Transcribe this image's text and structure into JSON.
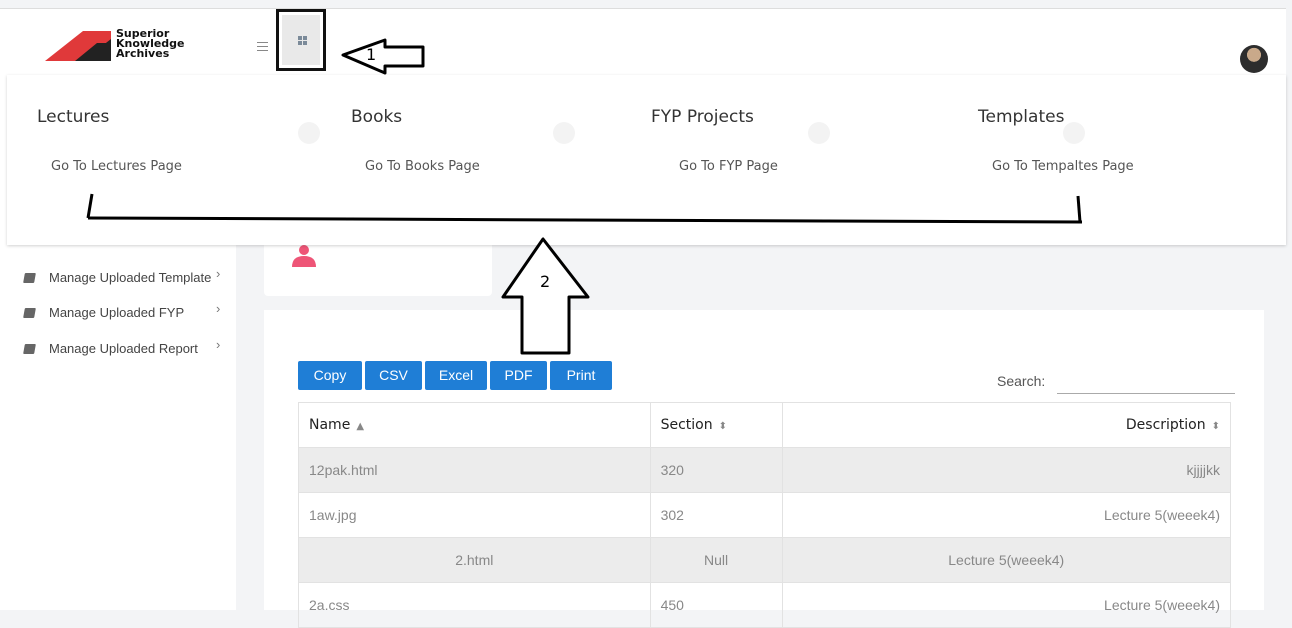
{
  "app": {
    "logo_lines": [
      "Superior",
      "Knowledge",
      "Archives"
    ]
  },
  "sidebar": {
    "items": [
      {
        "label": "Manage Uploaded Template",
        "icon": "book-icon"
      },
      {
        "label": "Manage Uploaded FYP",
        "icon": "book-icon"
      },
      {
        "label": "Manage Uploaded Report",
        "icon": "book-icon"
      }
    ]
  },
  "mega_menu": {
    "sections": [
      {
        "title": "Lectures",
        "link": "Go To Lectures Page"
      },
      {
        "title": "Books",
        "link": "Go To Books Page"
      },
      {
        "title": "FYP Projects",
        "link": "Go To FYP Page"
      },
      {
        "title": "Templates",
        "link": "Go To Tempaltes Page"
      }
    ]
  },
  "annotations": {
    "arrow1_label": "1",
    "arrow2_label": "2"
  },
  "toolbar": {
    "buttons": [
      "Copy",
      "CSV",
      "Excel",
      "PDF",
      "Print"
    ],
    "search_label": "Search:",
    "search_value": ""
  },
  "table": {
    "columns": [
      "Name",
      "Section",
      "Description"
    ],
    "sort_icons": [
      "sort-asc-icon",
      "sort-both-icon",
      "sort-both-icon"
    ],
    "rows": [
      [
        "12pak.html",
        "320",
        "kjjjjkk"
      ],
      [
        "1aw.jpg",
        "302",
        "Lecture 5(weeek4)"
      ],
      [
        "2.html",
        "Null",
        "Lecture 5(weeek4)"
      ],
      [
        "2a.css",
        "450",
        "Lecture 5(weeek4)"
      ]
    ]
  },
  "colors": {
    "button_blue": "#1f7ed6",
    "logo_red": "#e0393a",
    "logo_dark": "#222222",
    "user_icon_pink": "#ee5577"
  }
}
